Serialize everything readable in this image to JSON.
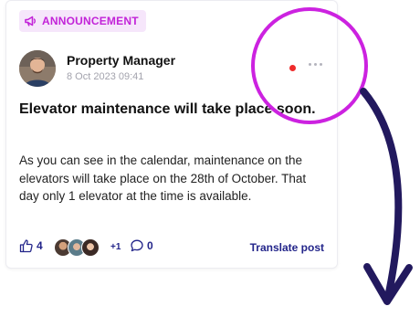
{
  "post": {
    "badge": "ANNOUNCEMENT",
    "author": "Property Manager",
    "timestamp": "8 Oct 2023 09:41",
    "title": "Elevator maintenance will take place soon.",
    "body": "As you can see in the calendar, maintenance on the elevators will take place on the 28th of October. That day only 1 elevator at the time is available.",
    "like_count": "4",
    "extra_reactors": "+1",
    "comment_count": "0",
    "translate_label": "Translate post"
  },
  "icons": {
    "badge": "megaphone-icon",
    "like": "thumbs-up-icon",
    "comment": "comment-icon",
    "menu": "more-horizontal-icon"
  },
  "colors": {
    "accent": "#c223d8",
    "badge_bg": "#f6e6fb",
    "link": "#23258a",
    "unread": "#ef2b2b",
    "annotation_circle": "#cc22e0",
    "annotation_arrow": "#22195e"
  }
}
